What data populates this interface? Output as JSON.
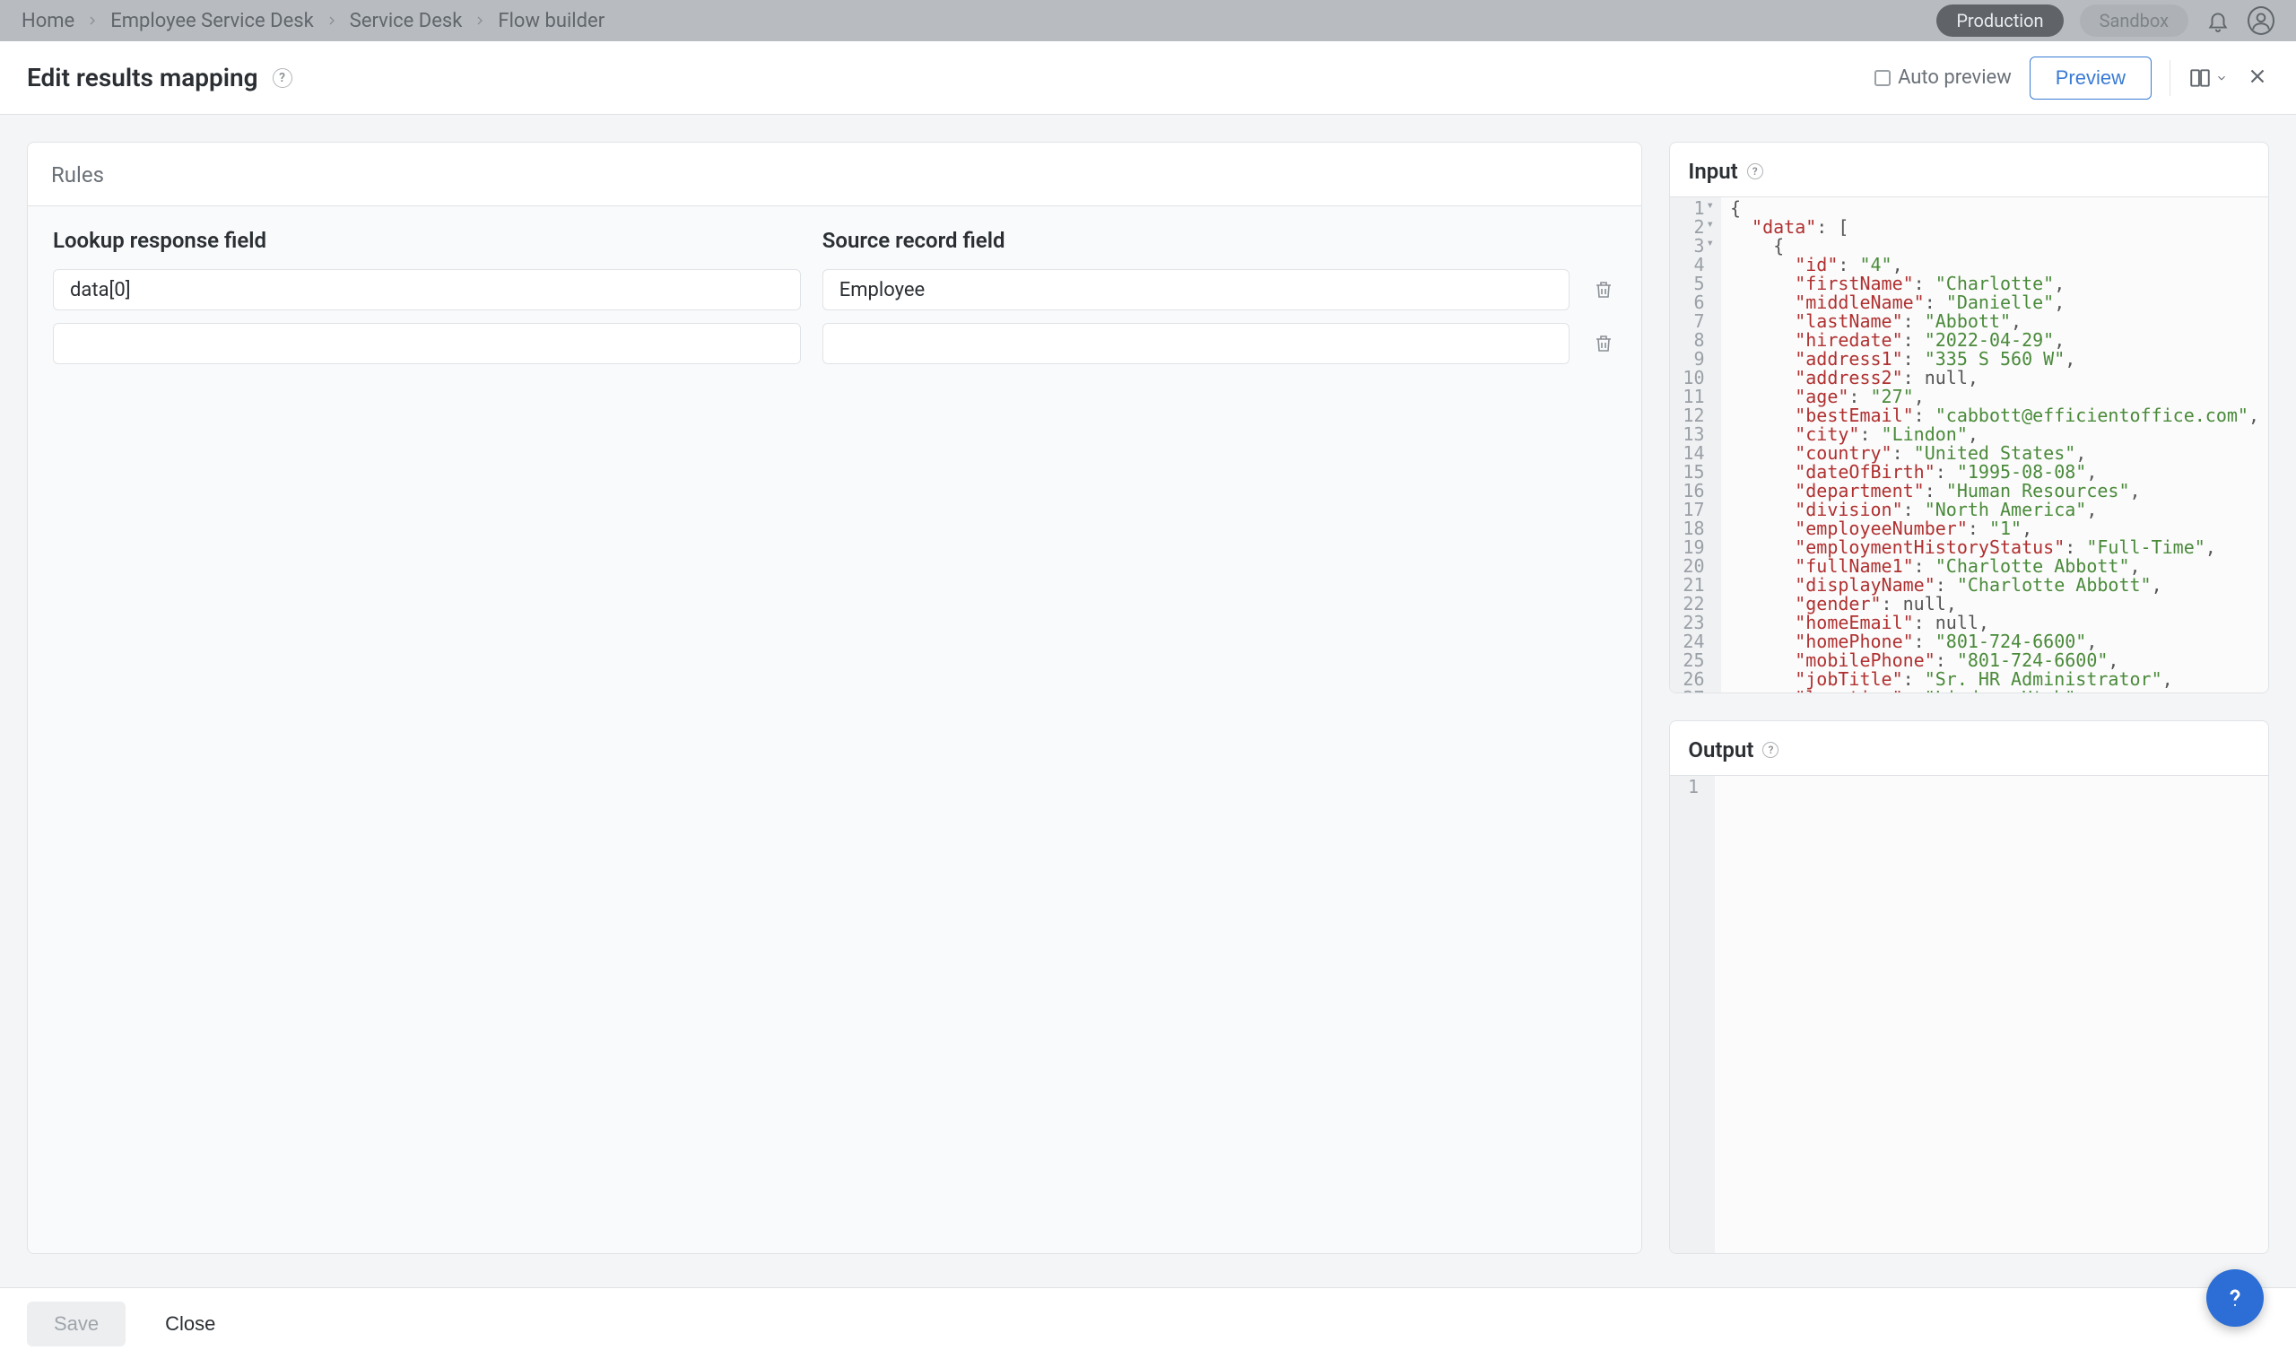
{
  "breadcrumbs": [
    "Home",
    "Employee Service Desk",
    "Service Desk",
    "Flow builder"
  ],
  "env": {
    "production": "Production",
    "sandbox": "Sandbox"
  },
  "header": {
    "title": "Edit results mapping",
    "autoPreview": "Auto preview",
    "preview": "Preview"
  },
  "rules": {
    "title": "Rules",
    "col1": "Lookup response field",
    "col2": "Source record field",
    "rows": [
      {
        "lookup": "data[0]",
        "source": "Employee"
      },
      {
        "lookup": "",
        "source": ""
      }
    ]
  },
  "inputLabel": "Input",
  "outputLabel": "Output",
  "footer": {
    "save": "Save",
    "close": "Close"
  },
  "inputJsonLines": [
    {
      "indent": 0,
      "tokens": [
        {
          "t": "p",
          "v": "{"
        }
      ],
      "fold": true
    },
    {
      "indent": 1,
      "tokens": [
        {
          "t": "k",
          "v": "\"data\""
        },
        {
          "t": "p",
          "v": ": ["
        }
      ],
      "fold": true
    },
    {
      "indent": 2,
      "tokens": [
        {
          "t": "p",
          "v": "{"
        }
      ],
      "fold": true
    },
    {
      "indent": 3,
      "tokens": [
        {
          "t": "k",
          "v": "\"id\""
        },
        {
          "t": "p",
          "v": ": "
        },
        {
          "t": "s",
          "v": "\"4\""
        },
        {
          "t": "p",
          "v": ","
        }
      ]
    },
    {
      "indent": 3,
      "tokens": [
        {
          "t": "k",
          "v": "\"firstName\""
        },
        {
          "t": "p",
          "v": ": "
        },
        {
          "t": "s",
          "v": "\"Charlotte\""
        },
        {
          "t": "p",
          "v": ","
        }
      ]
    },
    {
      "indent": 3,
      "tokens": [
        {
          "t": "k",
          "v": "\"middleName\""
        },
        {
          "t": "p",
          "v": ": "
        },
        {
          "t": "s",
          "v": "\"Danielle\""
        },
        {
          "t": "p",
          "v": ","
        }
      ]
    },
    {
      "indent": 3,
      "tokens": [
        {
          "t": "k",
          "v": "\"lastName\""
        },
        {
          "t": "p",
          "v": ": "
        },
        {
          "t": "s",
          "v": "\"Abbott\""
        },
        {
          "t": "p",
          "v": ","
        }
      ]
    },
    {
      "indent": 3,
      "tokens": [
        {
          "t": "k",
          "v": "\"hiredate\""
        },
        {
          "t": "p",
          "v": ": "
        },
        {
          "t": "s",
          "v": "\"2022-04-29\""
        },
        {
          "t": "p",
          "v": ","
        }
      ]
    },
    {
      "indent": 3,
      "tokens": [
        {
          "t": "k",
          "v": "\"address1\""
        },
        {
          "t": "p",
          "v": ": "
        },
        {
          "t": "s",
          "v": "\"335 S 560 W\""
        },
        {
          "t": "p",
          "v": ","
        }
      ]
    },
    {
      "indent": 3,
      "tokens": [
        {
          "t": "k",
          "v": "\"address2\""
        },
        {
          "t": "p",
          "v": ": "
        },
        {
          "t": "n",
          "v": "null"
        },
        {
          "t": "p",
          "v": ","
        }
      ]
    },
    {
      "indent": 3,
      "tokens": [
        {
          "t": "k",
          "v": "\"age\""
        },
        {
          "t": "p",
          "v": ": "
        },
        {
          "t": "s",
          "v": "\"27\""
        },
        {
          "t": "p",
          "v": ","
        }
      ]
    },
    {
      "indent": 3,
      "tokens": [
        {
          "t": "k",
          "v": "\"bestEmail\""
        },
        {
          "t": "p",
          "v": ": "
        },
        {
          "t": "s",
          "v": "\"cabbott@efficientoffice.com\""
        },
        {
          "t": "p",
          "v": ","
        }
      ]
    },
    {
      "indent": 3,
      "tokens": [
        {
          "t": "k",
          "v": "\"city\""
        },
        {
          "t": "p",
          "v": ": "
        },
        {
          "t": "s",
          "v": "\"Lindon\""
        },
        {
          "t": "p",
          "v": ","
        }
      ]
    },
    {
      "indent": 3,
      "tokens": [
        {
          "t": "k",
          "v": "\"country\""
        },
        {
          "t": "p",
          "v": ": "
        },
        {
          "t": "s",
          "v": "\"United States\""
        },
        {
          "t": "p",
          "v": ","
        }
      ]
    },
    {
      "indent": 3,
      "tokens": [
        {
          "t": "k",
          "v": "\"dateOfBirth\""
        },
        {
          "t": "p",
          "v": ": "
        },
        {
          "t": "s",
          "v": "\"1995-08-08\""
        },
        {
          "t": "p",
          "v": ","
        }
      ]
    },
    {
      "indent": 3,
      "tokens": [
        {
          "t": "k",
          "v": "\"department\""
        },
        {
          "t": "p",
          "v": ": "
        },
        {
          "t": "s",
          "v": "\"Human Resources\""
        },
        {
          "t": "p",
          "v": ","
        }
      ]
    },
    {
      "indent": 3,
      "tokens": [
        {
          "t": "k",
          "v": "\"division\""
        },
        {
          "t": "p",
          "v": ": "
        },
        {
          "t": "s",
          "v": "\"North America\""
        },
        {
          "t": "p",
          "v": ","
        }
      ]
    },
    {
      "indent": 3,
      "tokens": [
        {
          "t": "k",
          "v": "\"employeeNumber\""
        },
        {
          "t": "p",
          "v": ": "
        },
        {
          "t": "s",
          "v": "\"1\""
        },
        {
          "t": "p",
          "v": ","
        }
      ]
    },
    {
      "indent": 3,
      "tokens": [
        {
          "t": "k",
          "v": "\"employmentHistoryStatus\""
        },
        {
          "t": "p",
          "v": ": "
        },
        {
          "t": "s",
          "v": "\"Full-Time\""
        },
        {
          "t": "p",
          "v": ","
        }
      ]
    },
    {
      "indent": 3,
      "tokens": [
        {
          "t": "k",
          "v": "\"fullName1\""
        },
        {
          "t": "p",
          "v": ": "
        },
        {
          "t": "s",
          "v": "\"Charlotte Abbott\""
        },
        {
          "t": "p",
          "v": ","
        }
      ]
    },
    {
      "indent": 3,
      "tokens": [
        {
          "t": "k",
          "v": "\"displayName\""
        },
        {
          "t": "p",
          "v": ": "
        },
        {
          "t": "s",
          "v": "\"Charlotte Abbott\""
        },
        {
          "t": "p",
          "v": ","
        }
      ]
    },
    {
      "indent": 3,
      "tokens": [
        {
          "t": "k",
          "v": "\"gender\""
        },
        {
          "t": "p",
          "v": ": "
        },
        {
          "t": "n",
          "v": "null"
        },
        {
          "t": "p",
          "v": ","
        }
      ]
    },
    {
      "indent": 3,
      "tokens": [
        {
          "t": "k",
          "v": "\"homeEmail\""
        },
        {
          "t": "p",
          "v": ": "
        },
        {
          "t": "n",
          "v": "null"
        },
        {
          "t": "p",
          "v": ","
        }
      ]
    },
    {
      "indent": 3,
      "tokens": [
        {
          "t": "k",
          "v": "\"homePhone\""
        },
        {
          "t": "p",
          "v": ": "
        },
        {
          "t": "s",
          "v": "\"801-724-6600\""
        },
        {
          "t": "p",
          "v": ","
        }
      ]
    },
    {
      "indent": 3,
      "tokens": [
        {
          "t": "k",
          "v": "\"mobilePhone\""
        },
        {
          "t": "p",
          "v": ": "
        },
        {
          "t": "s",
          "v": "\"801-724-6600\""
        },
        {
          "t": "p",
          "v": ","
        }
      ]
    },
    {
      "indent": 3,
      "tokens": [
        {
          "t": "k",
          "v": "\"jobTitle\""
        },
        {
          "t": "p",
          "v": ": "
        },
        {
          "t": "s",
          "v": "\"Sr. HR Administrator\""
        },
        {
          "t": "p",
          "v": ","
        }
      ]
    },
    {
      "indent": 3,
      "tokens": [
        {
          "t": "k",
          "v": "\"location\""
        },
        {
          "t": "p",
          "v": ": "
        },
        {
          "t": "s",
          "v": "\"Lindon, Utah\""
        }
      ]
    }
  ],
  "outputGutterStart": 1
}
